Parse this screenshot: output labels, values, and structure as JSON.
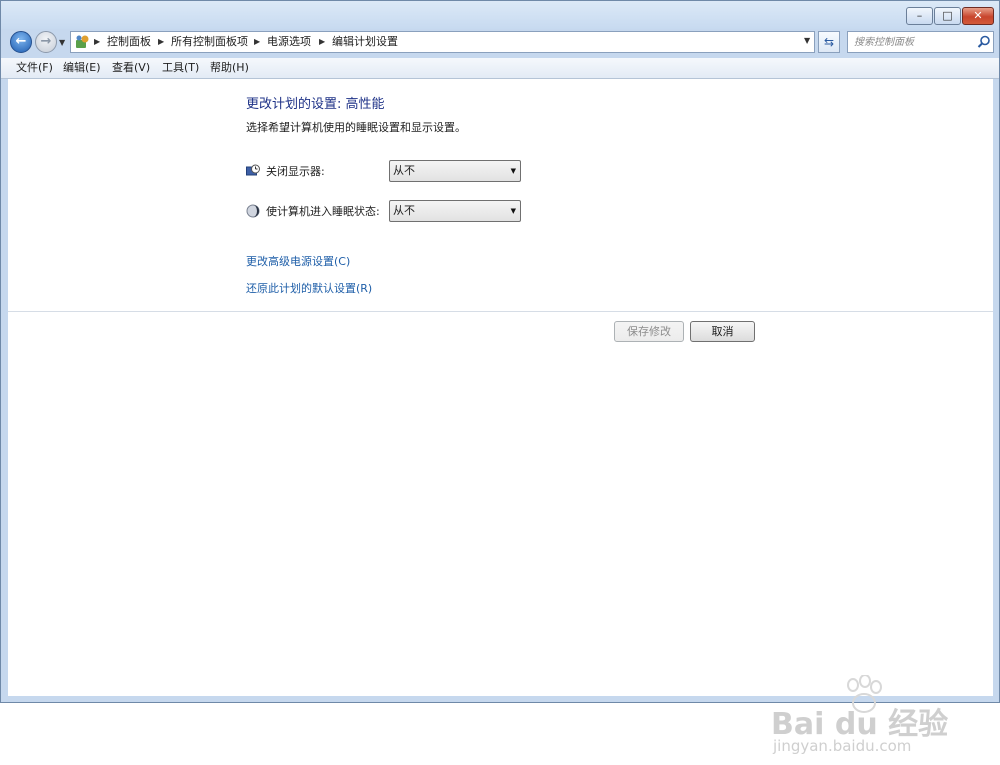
{
  "window": {
    "minimize_glyph": "–",
    "maximize_glyph": "□",
    "close_glyph": "✕"
  },
  "nav": {
    "back_glyph": "←",
    "forward_glyph": "→",
    "recent_glyph": "▼",
    "refresh_glyph": "⇆"
  },
  "breadcrumb": {
    "items": [
      "控制面板",
      "所有控制面板项",
      "电源选项",
      "编辑计划设置"
    ],
    "separator": "▶",
    "dropdown_glyph": "▼"
  },
  "search": {
    "placeholder": "搜索控制面板",
    "icon": "magnifier-icon"
  },
  "menu": {
    "items": [
      "文件(F)",
      "编辑(E)",
      "查看(V)",
      "工具(T)",
      "帮助(H)"
    ]
  },
  "main": {
    "title": "更改计划的设置: 高性能",
    "subtitle": "选择希望计算机使用的睡眠设置和显示设置。",
    "settings": [
      {
        "label": "关闭显示器:",
        "value": "从不",
        "icon": "monitor-clock-icon"
      },
      {
        "label": "使计算机进入睡眠状态:",
        "value": "从不",
        "icon": "moon-sleep-icon"
      }
    ],
    "links": [
      "更改高级电源设置(C)",
      "还原此计划的默认设置(R)"
    ],
    "save_label": "保存修改",
    "cancel_label": "取消"
  },
  "watermark": {
    "brand": "Bai du 经验",
    "url": "jingyan.baidu.com"
  },
  "colors": {
    "title_blue": "#1e3287",
    "link_blue": "#1e5ea8",
    "frame": "#c6d8ee"
  }
}
